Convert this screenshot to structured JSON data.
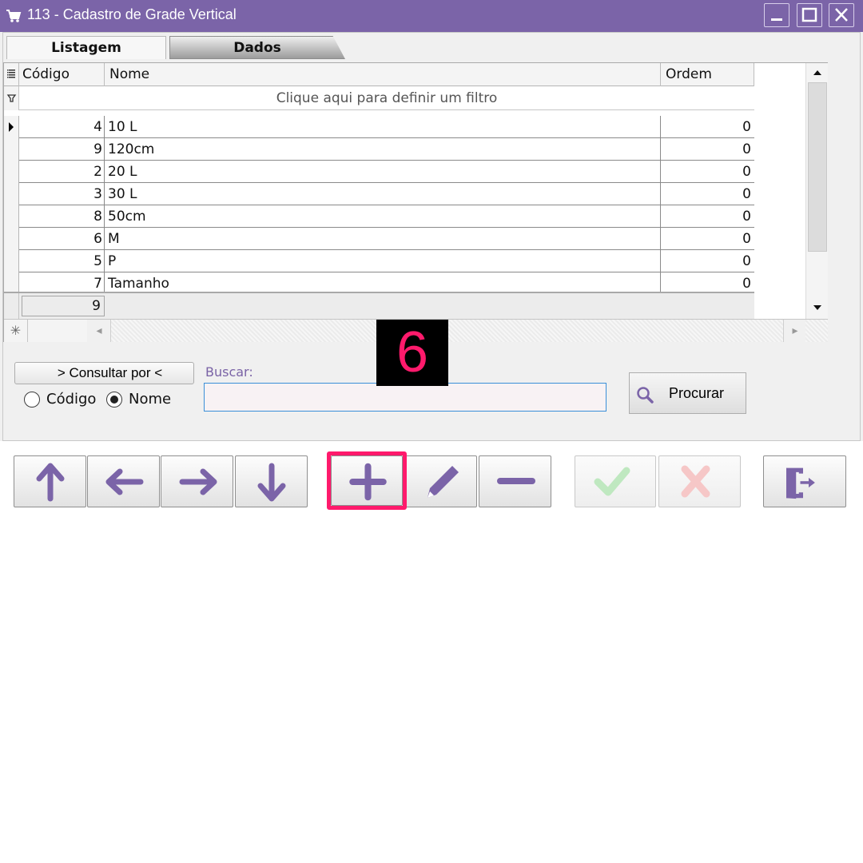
{
  "window": {
    "title": "113 - Cadastro de Grade Vertical",
    "title_bar_color": "#7b64a8",
    "icons": [
      "cart-icon",
      "minimize-icon",
      "maximize-icon",
      "close-icon"
    ]
  },
  "tabs": [
    {
      "label": "Listagem",
      "active": true
    },
    {
      "label": "Dados",
      "active": false
    }
  ],
  "grid": {
    "columns": [
      "Código",
      "Nome",
      "Ordem"
    ],
    "filter_hint": "Clique aqui para definir um filtro",
    "rows": [
      {
        "codigo": "4",
        "nome": "10 L",
        "ordem": "0",
        "selected": true
      },
      {
        "codigo": "9",
        "nome": "120cm",
        "ordem": "0"
      },
      {
        "codigo": "2",
        "nome": "20 L",
        "ordem": "0"
      },
      {
        "codigo": "3",
        "nome": "30 L",
        "ordem": "0"
      },
      {
        "codigo": "8",
        "nome": "50cm",
        "ordem": "0"
      },
      {
        "codigo": "6",
        "nome": "M",
        "ordem": "0"
      },
      {
        "codigo": "5",
        "nome": "P",
        "ordem": "0"
      },
      {
        "codigo": "7",
        "nome": "Tamanho",
        "ordem": "0"
      }
    ],
    "footer_count": "9"
  },
  "search": {
    "consultar_label": "> Consultar por <",
    "options": [
      {
        "label": "Código",
        "selected": false
      },
      {
        "label": "Nome",
        "selected": true
      }
    ],
    "buscar_label": "Buscar:",
    "buscar_value": "",
    "procurar_label": "Procurar"
  },
  "step_badge": "6",
  "toolbar": {
    "buttons": [
      {
        "name": "up-arrow-icon",
        "enabled": true
      },
      {
        "name": "left-arrow-icon",
        "enabled": true
      },
      {
        "name": "right-arrow-icon",
        "enabled": true
      },
      {
        "name": "down-arrow-icon",
        "enabled": true
      },
      {
        "name": "plus-icon",
        "enabled": true,
        "highlighted": true
      },
      {
        "name": "pencil-icon",
        "enabled": true
      },
      {
        "name": "minus-icon",
        "enabled": true
      },
      {
        "name": "check-icon",
        "enabled": false
      },
      {
        "name": "x-icon",
        "enabled": false
      },
      {
        "name": "exit-door-icon",
        "enabled": true
      }
    ],
    "icon_color": "#7b64a8",
    "highlight_color": "#ff1a6c"
  }
}
